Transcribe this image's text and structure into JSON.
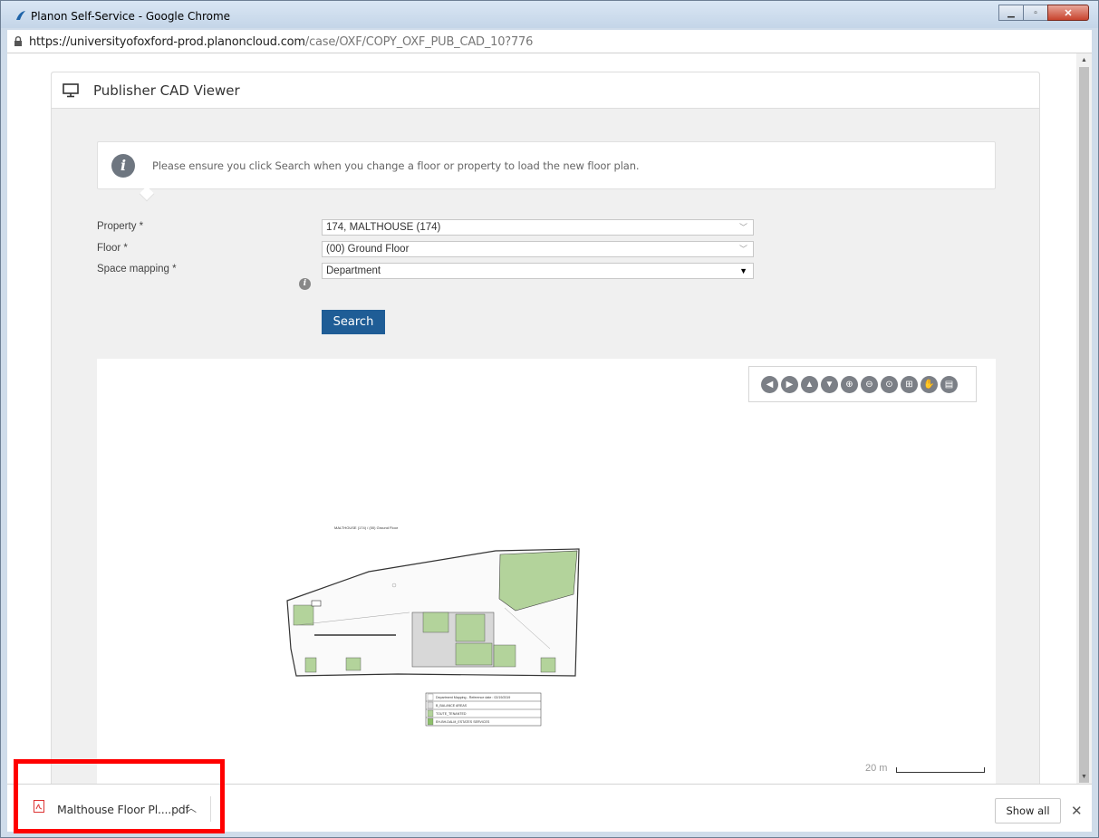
{
  "window": {
    "title": "Planon Self-Service - Google Chrome",
    "controls": [
      "minimize",
      "maximize",
      "close"
    ]
  },
  "address_bar": {
    "host": "https://universityofoxford-prod.planoncloud.com",
    "path": "/case/OXF/COPY_OXF_PUB_CAD_10?776"
  },
  "card": {
    "title": "Publisher CAD Viewer",
    "alert": "Please ensure you click Search when you change a floor or property to load the new floor plan."
  },
  "form": {
    "property_label": "Property *",
    "property_value": "174, MALTHOUSE (174)",
    "floor_label": "Floor *",
    "floor_value": "(00) Ground Floor",
    "space_mapping_label": "Space mapping *",
    "space_mapping_value": "Department",
    "search_label": "Search"
  },
  "cad": {
    "toolbar_icons": [
      "pan-left-icon",
      "pan-right-icon",
      "pan-up-icon",
      "pan-down-icon",
      "zoom-in-icon",
      "zoom-out-icon",
      "fit-extent-icon",
      "zoom-window-icon",
      "hand-pan-icon",
      "pdf-export-icon"
    ],
    "plan_title": "MALTHOUSE (174) / (00) Ground Floor",
    "legend": [
      "Department Mapping - Reference date : 02/19/2019",
      "B_BALANCE AREAS",
      "TOUTE_TENANTED",
      "EH-BH-DALM_ESTATES SERVICES"
    ],
    "scale_label": "20 m",
    "colors": {
      "room_fill": "#b3d39b",
      "wall": "#333333"
    }
  },
  "downloads": {
    "file_name": "Malthouse Floor Pl....pdf",
    "show_all": "Show all",
    "close": "✕"
  },
  "colors": {
    "primary_button": "#1f5d96",
    "highlight": "#ff0000"
  }
}
